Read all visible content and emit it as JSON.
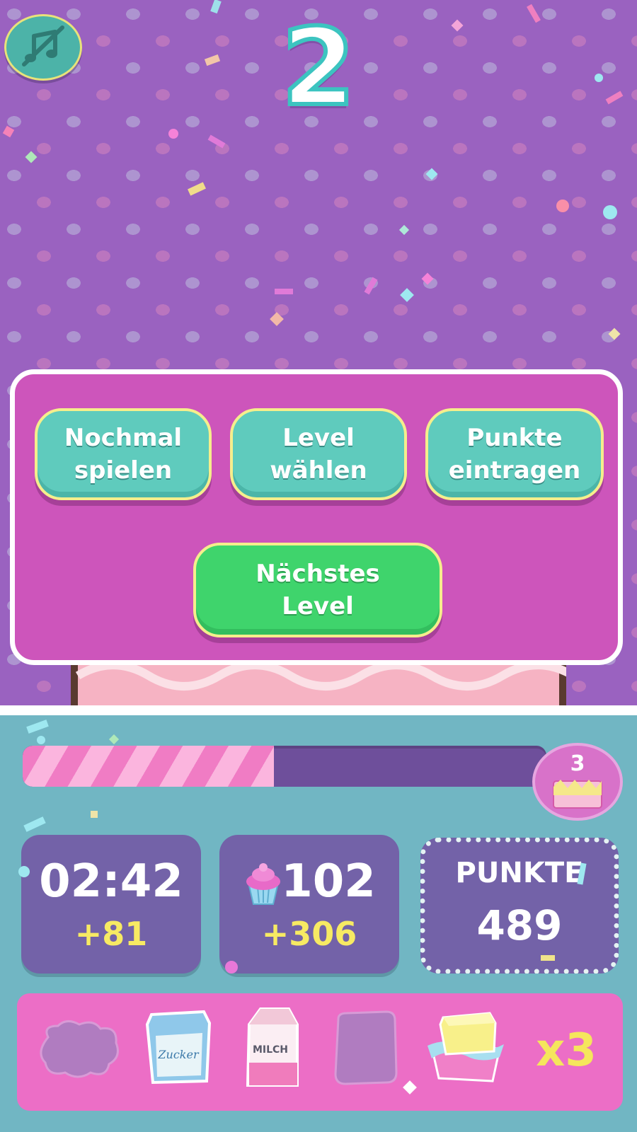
{
  "game": {
    "level_number": "2",
    "music_button": {
      "icon": "music-muted-icon",
      "muted": true
    }
  },
  "dialog": {
    "buttons": {
      "play_again": [
        "Nochmal",
        "spielen"
      ],
      "select_level": [
        "Level",
        "wählen"
      ],
      "submit_score": [
        "Punkte",
        "eintragen"
      ],
      "next_level": [
        "Nächstes",
        "Level"
      ]
    }
  },
  "hud": {
    "progress": {
      "fraction": 0.48,
      "goal_level": "3",
      "goal_icon": "cake-icon"
    },
    "timer": {
      "value": "02:42",
      "bonus": "+81"
    },
    "cupcakes": {
      "icon": "cupcake-icon",
      "value": "102",
      "bonus": "+306"
    },
    "points": {
      "label": "PUNKTE",
      "value": "489"
    }
  },
  "ingredients": {
    "items": [
      {
        "name": "empty-splat-slot-icon"
      },
      {
        "name": "sugar-bag-icon",
        "label": "Zucker"
      },
      {
        "name": "milk-carton-icon",
        "label": "MILCH"
      },
      {
        "name": "empty-slot-icon"
      },
      {
        "name": "butter-block-icon"
      }
    ],
    "multiplier": "x3"
  },
  "colors": {
    "background_purple": "#9a62c0",
    "dialog_pink": "#cd55bb",
    "button_teal": "#5fcbbd",
    "button_green": "#3fd46c",
    "hud_teal": "#71b6c3",
    "stat_purple": "#7362a8",
    "bonus_yellow": "#f7ea63"
  }
}
